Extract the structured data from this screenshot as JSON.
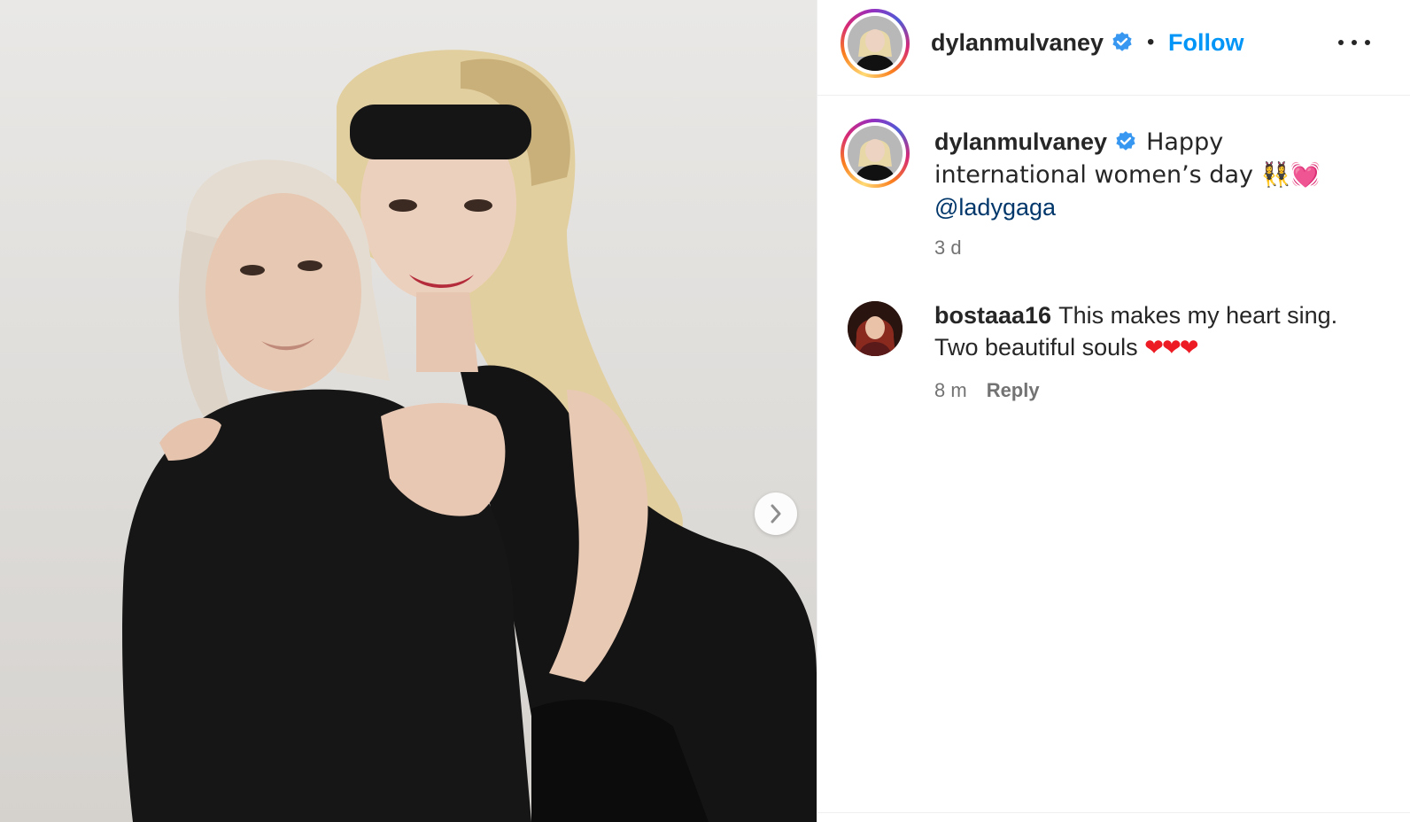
{
  "post": {
    "image": {
      "alt": "",
      "next_icon": "chevron-right-icon"
    },
    "header": {
      "username": "dylanmulvaney",
      "verified_icon": "verified-badge-icon",
      "separator": "•",
      "follow_label": "Follow",
      "more_icon": "more-options-icon"
    },
    "caption": {
      "username": "dylanmulvaney",
      "text": "Happy international women’s day 👯‍♀️💓",
      "mention": "@ladygaga",
      "time": "3 d"
    },
    "comments": [
      {
        "username": "bostaaa16",
        "text": "This makes my heart sing. Two beautiful souls",
        "hearts": "❤❤❤",
        "time": "8 m",
        "reply_label": "Reply"
      }
    ]
  },
  "colors": {
    "follow": "#0095f6",
    "mention": "#00376b",
    "verified": "#3897f0",
    "muted": "#737373",
    "text": "#262626"
  }
}
